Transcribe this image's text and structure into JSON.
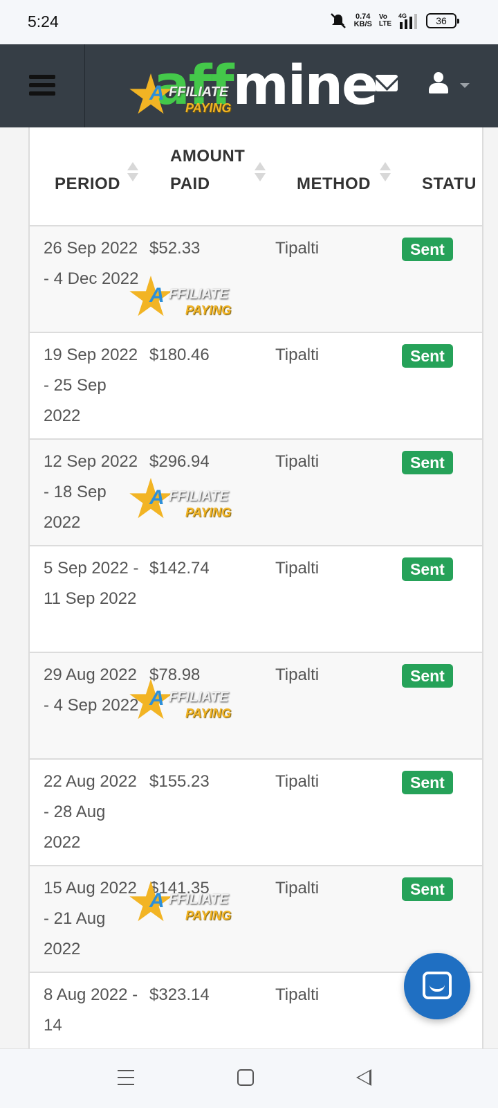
{
  "status_bar": {
    "time": "5:24",
    "net_speed_value": "0.74",
    "net_speed_unit": "KB/S",
    "volte_top": "Vo",
    "volte_bottom": "LTE",
    "network": "4G",
    "battery": "36"
  },
  "header": {
    "logo_part1": "aff",
    "logo_part2": "mine",
    "logo_colors": {
      "part1": "#44c84a",
      "part2": "#ffffff"
    },
    "background": "#363e46",
    "icons": [
      "menu-icon",
      "mail-icon",
      "user-icon",
      "caret-down-icon"
    ]
  },
  "table": {
    "columns": [
      {
        "line1": "PERIOD",
        "line2": ""
      },
      {
        "line1": "AMOUNT",
        "line2": "PAID"
      },
      {
        "line1": "METHOD",
        "line2": ""
      },
      {
        "line1": "STATU",
        "line2": ""
      }
    ],
    "rows": [
      {
        "period": "26 Sep 2022 - 4 Dec 2022",
        "amount": "$52.33",
        "method": "Tipalti",
        "status": "Sent"
      },
      {
        "period": "19 Sep 2022 - 25 Sep 2022",
        "amount": "$180.46",
        "method": "Tipalti",
        "status": "Sent"
      },
      {
        "period": "12 Sep 2022 - 18 Sep 2022",
        "amount": "$296.94",
        "method": "Tipalti",
        "status": "Sent"
      },
      {
        "period": "5 Sep 2022 - 11 Sep 2022",
        "amount": "$142.74",
        "method": "Tipalti",
        "status": "Sent"
      },
      {
        "period": "29 Aug 2022 - 4 Sep 2022",
        "amount": "$78.98",
        "method": "Tipalti",
        "status": "Sent"
      },
      {
        "period": "22 Aug 2022 - 28 Aug 2022",
        "amount": "$155.23",
        "method": "Tipalti",
        "status": "Sent"
      },
      {
        "period": "15 Aug 2022 - 21 Aug 2022",
        "amount": "$141.35",
        "method": "Tipalti",
        "status": "Sent"
      },
      {
        "period": "8 Aug 2022 - 14",
        "amount": "$323.14",
        "method": "Tipalti",
        "status": ""
      }
    ],
    "status_color": "#26a259"
  },
  "watermark": {
    "line1": "A",
    "line2": "FFILIATE",
    "line3": "PAYING"
  },
  "chat": {
    "icon": "chat-icon",
    "color": "#1f6fc2"
  },
  "nav": {
    "icons": [
      "recents-icon",
      "home-icon",
      "back-icon"
    ]
  }
}
